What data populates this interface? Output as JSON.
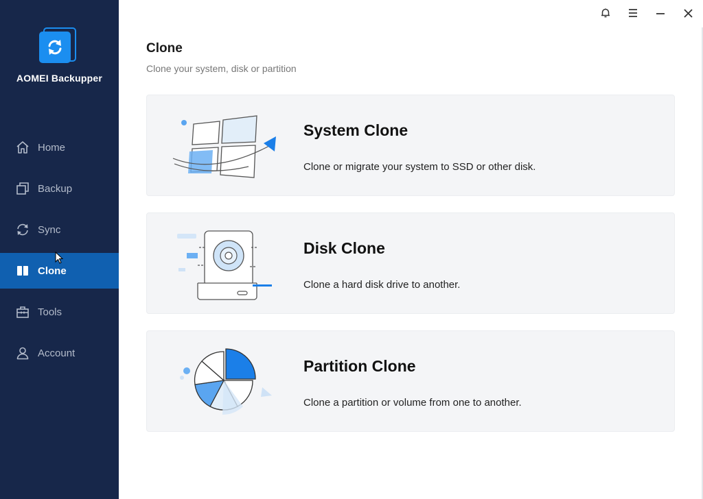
{
  "app": {
    "name": "AOMEI Backupper"
  },
  "nav": {
    "items": [
      {
        "label": "Home",
        "icon": "home-icon",
        "active": false
      },
      {
        "label": "Backup",
        "icon": "backup-icon",
        "active": false
      },
      {
        "label": "Sync",
        "icon": "sync-icon",
        "active": false
      },
      {
        "label": "Clone",
        "icon": "clone-icon",
        "active": true
      },
      {
        "label": "Tools",
        "icon": "tools-icon",
        "active": false
      },
      {
        "label": "Account",
        "icon": "account-icon",
        "active": false
      }
    ]
  },
  "topbar": {
    "icons": [
      "bell-icon",
      "menu-icon",
      "minimize-icon",
      "close-icon"
    ]
  },
  "page": {
    "title": "Clone",
    "subtitle": "Clone your system, disk or partition"
  },
  "cards": [
    {
      "title": "System Clone",
      "description": "Clone or migrate your system to SSD or other disk.",
      "icon": "system-clone-illustration"
    },
    {
      "title": "Disk Clone",
      "description": "Clone a hard disk drive to another.",
      "icon": "disk-clone-illustration"
    },
    {
      "title": "Partition Clone",
      "description": "Clone a partition or volume from one to another.",
      "icon": "partition-clone-illustration"
    }
  ],
  "colors": {
    "sidebar_bg": "#17274a",
    "active_nav": "#1060b0",
    "accent": "#1b8ef0",
    "card_bg": "#f4f5f7"
  }
}
